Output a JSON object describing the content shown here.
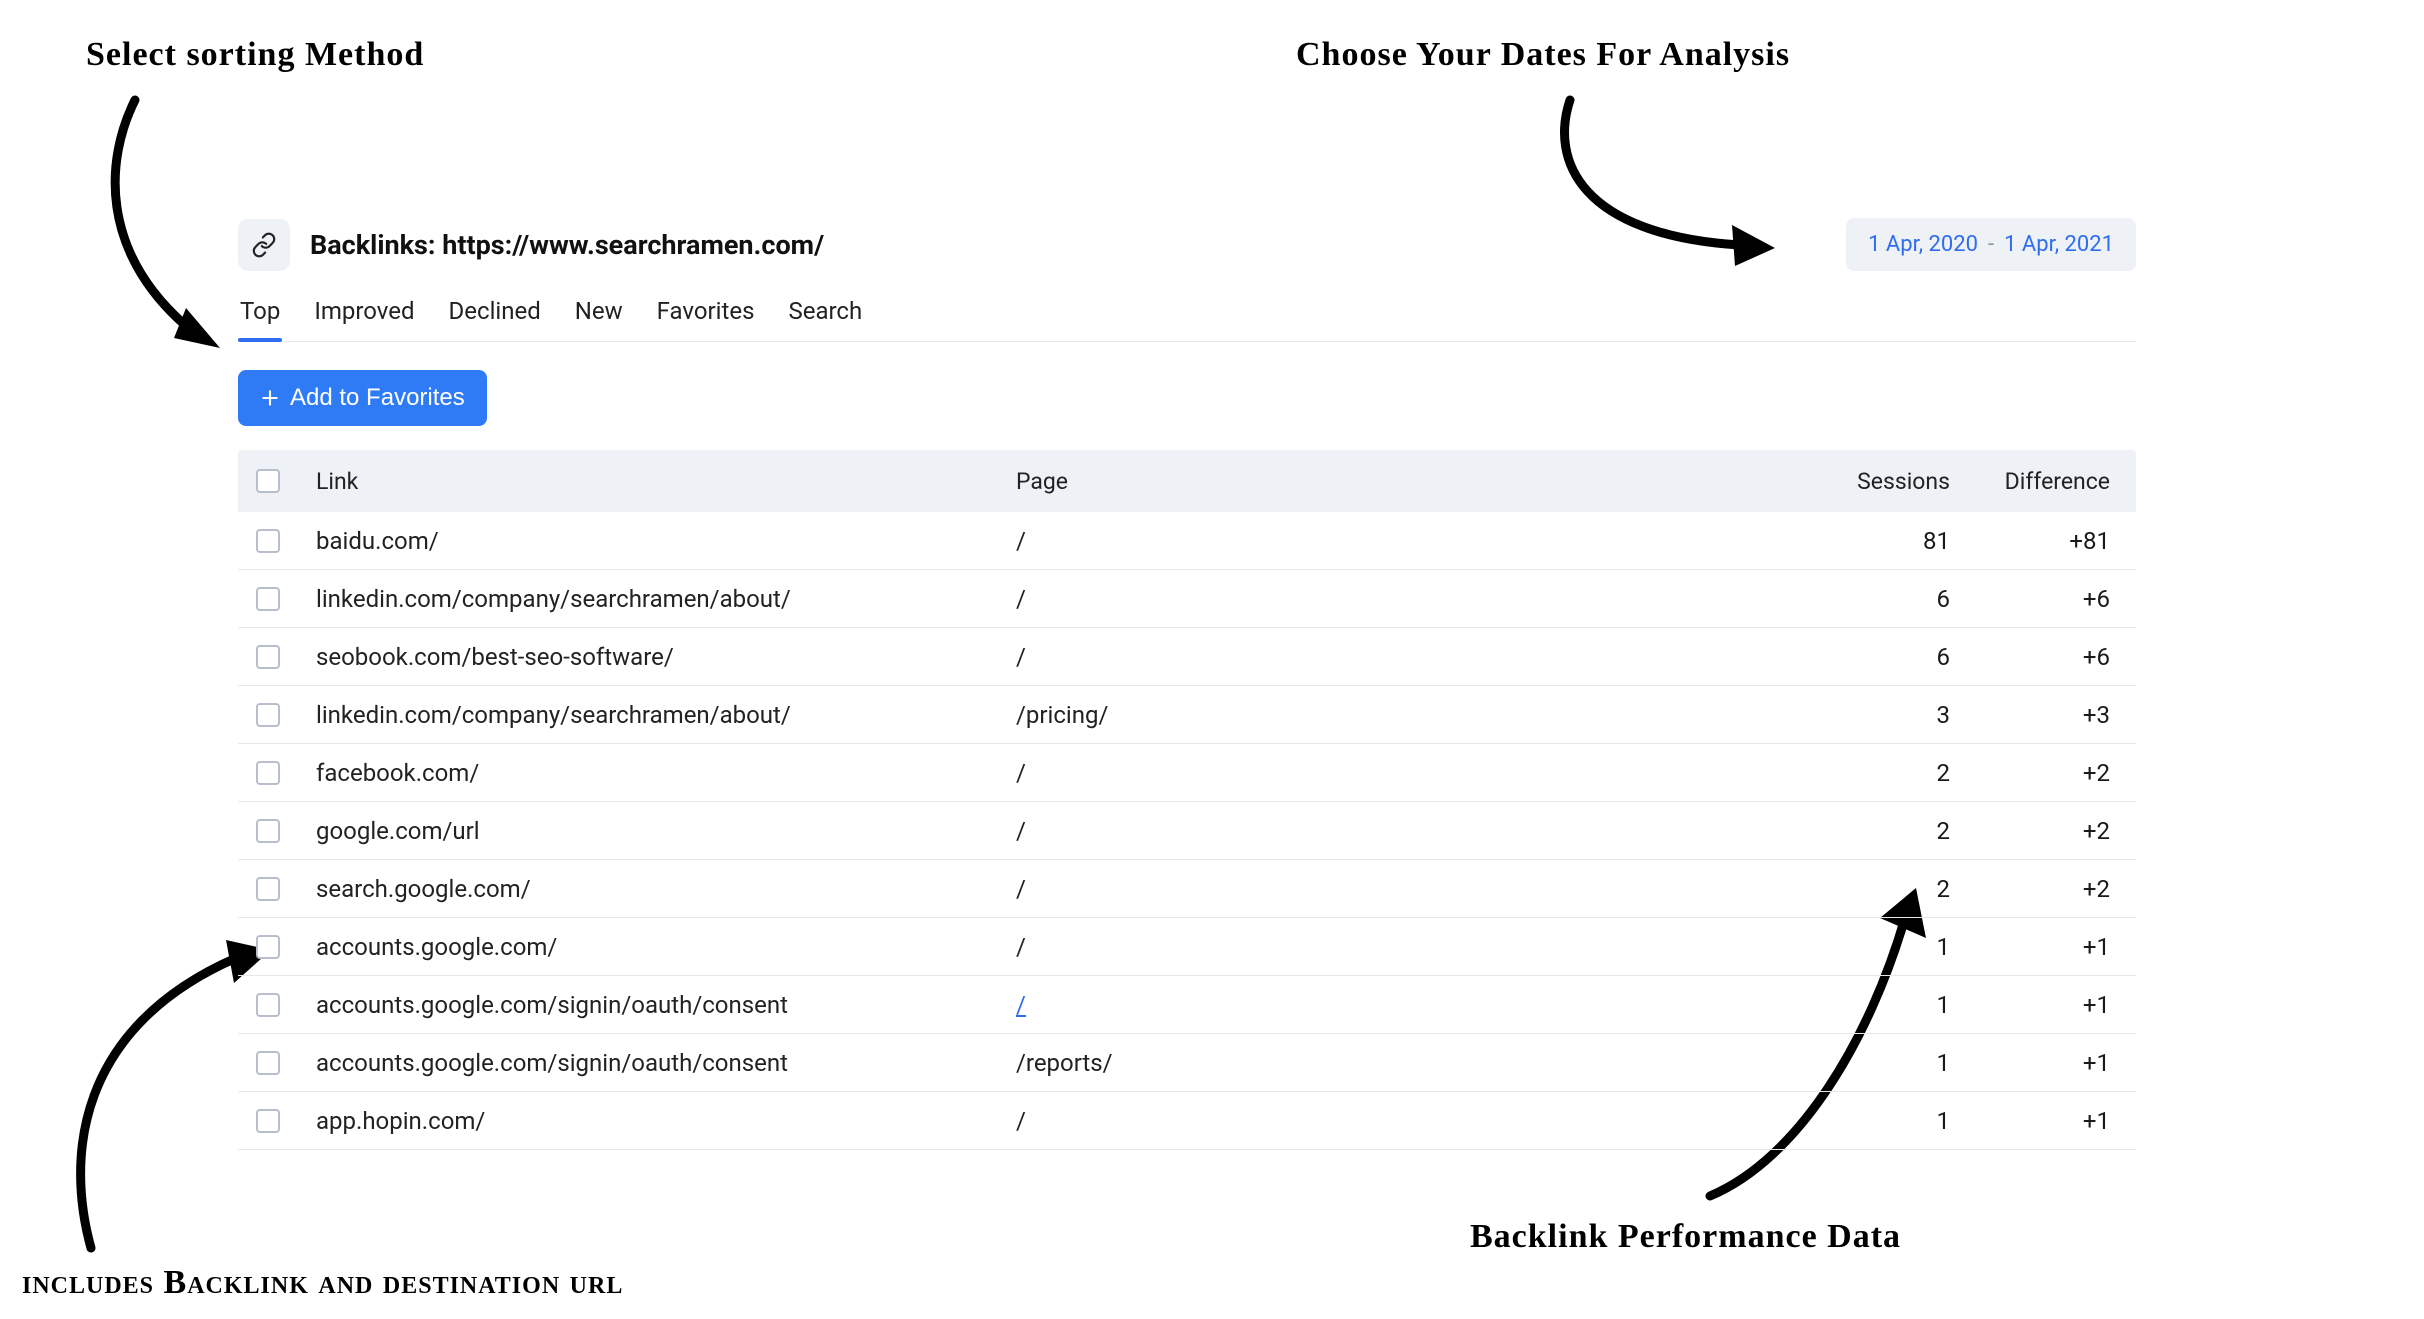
{
  "annotations": {
    "sorting": "Select sorting Method",
    "dates": "Choose Your Dates For Analysis",
    "backlink_url": "includes Backlink and destination url",
    "performance": "Backlink Performance Data"
  },
  "header": {
    "title": "Backlinks: https://www.searchramen.com/",
    "date_from": "1 Apr, 2020",
    "date_to": "1 Apr, 2021"
  },
  "tabs": [
    {
      "label": "Top",
      "active": true
    },
    {
      "label": "Improved",
      "active": false
    },
    {
      "label": "Declined",
      "active": false
    },
    {
      "label": "New",
      "active": false
    },
    {
      "label": "Favorites",
      "active": false
    },
    {
      "label": "Search",
      "active": false
    }
  ],
  "buttons": {
    "add_favorites": "Add to Favorites"
  },
  "columns": {
    "link": "Link",
    "page": "Page",
    "sessions": "Sessions",
    "difference": "Difference"
  },
  "rows": [
    {
      "link": "baidu.com/",
      "page": "/",
      "sessions": "81",
      "difference": "+81",
      "page_is_link": false
    },
    {
      "link": "linkedin.com/company/searchramen/about/",
      "page": "/",
      "sessions": "6",
      "difference": "+6",
      "page_is_link": false
    },
    {
      "link": "seobook.com/best-seo-software/",
      "page": "/",
      "sessions": "6",
      "difference": "+6",
      "page_is_link": false
    },
    {
      "link": "linkedin.com/company/searchramen/about/",
      "page": "/pricing/",
      "sessions": "3",
      "difference": "+3",
      "page_is_link": false
    },
    {
      "link": "facebook.com/",
      "page": "/",
      "sessions": "2",
      "difference": "+2",
      "page_is_link": false
    },
    {
      "link": "google.com/url",
      "page": "/",
      "sessions": "2",
      "difference": "+2",
      "page_is_link": false
    },
    {
      "link": "search.google.com/",
      "page": "/",
      "sessions": "2",
      "difference": "+2",
      "page_is_link": false
    },
    {
      "link": "accounts.google.com/",
      "page": "/",
      "sessions": "1",
      "difference": "+1",
      "page_is_link": false
    },
    {
      "link": "accounts.google.com/signin/oauth/consent",
      "page": "/",
      "sessions": "1",
      "difference": "+1",
      "page_is_link": true
    },
    {
      "link": "accounts.google.com/signin/oauth/consent",
      "page": "/reports/",
      "sessions": "1",
      "difference": "+1",
      "page_is_link": false
    },
    {
      "link": "app.hopin.com/",
      "page": "/",
      "sessions": "1",
      "difference": "+1",
      "page_is_link": false
    }
  ]
}
